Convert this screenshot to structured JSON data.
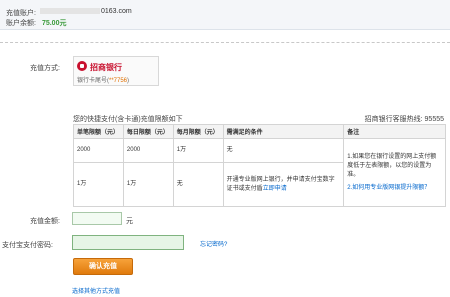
{
  "account": {
    "label_account": "充值账户:",
    "email": "0163.com",
    "label_balance": "账户余额:",
    "balance": "75.00元"
  },
  "method": {
    "label": "充值方式:",
    "bank_name": "招商银行",
    "card_tail_label": "银行卡尾号(",
    "card_number": "**7756",
    "card_tail_close": ")"
  },
  "quota": {
    "title": "您的快捷支付(含卡通)充值限额如下",
    "hotline_label": "招商银行客服热线:",
    "hotline_number": "95555",
    "headers": [
      "单笔限额（元）",
      "每日限额（元）",
      "每月限额（元）",
      "需满足的条件",
      "备注"
    ],
    "rows": [
      [
        "2000",
        "2000",
        "1万",
        "无"
      ],
      [
        "1万",
        "1万",
        "无",
        "开通专业版网上银行，并申请支付宝数字证书或支付盾",
        "立即申请"
      ]
    ],
    "notes": [
      "1.如果您在银行设置的网上支付额度低于左表限额，以您的设置为准。",
      "2.如何用专业版网银提升限额？"
    ]
  },
  "form": {
    "amount_label": "充值金额:",
    "amount_value": "",
    "unit": "元",
    "password_label": "支付宝支付密码:",
    "forgot_link": "忘记密码?",
    "confirm_button": "确认充值",
    "other_methods_link": "选择其他方式充值"
  },
  "colors": {
    "accent_orange": "#e07a0c",
    "link_blue": "#0066cc",
    "balance_green": "#3a9a3a",
    "bank_red": "#c8102e"
  }
}
